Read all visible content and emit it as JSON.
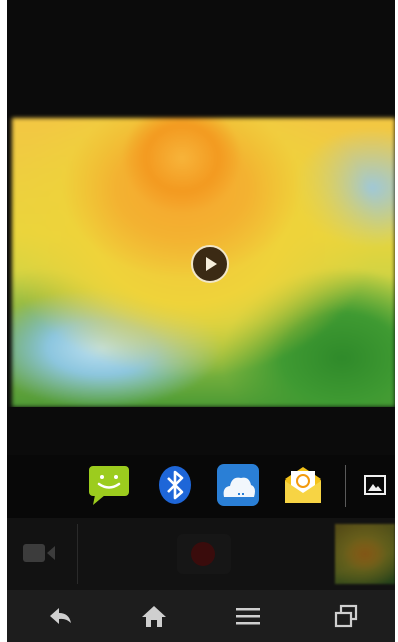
{
  "camera": {
    "preview": {
      "subject": "sunflower-video-frame",
      "play_icon": "play-icon"
    },
    "share_apps": [
      {
        "icon": "messaging-icon",
        "color": "#9ccc1e"
      },
      {
        "icon": "bluetooth-icon",
        "color": "#1e66d8"
      },
      {
        "icon": "cloud-storage-icon",
        "color": "#2a7fd6"
      },
      {
        "icon": "email-icon",
        "color": "#f3c21a"
      }
    ],
    "controls": {
      "mode_icon": "video-camera-icon",
      "shutter_icon": "record-icon",
      "thumbnail": "last-capture-thumbnail"
    }
  },
  "nav": {
    "buttons": [
      "back-icon",
      "home-icon",
      "menu-icon",
      "recent-apps-icon"
    ]
  },
  "colors": {
    "background": "#0c0c0c",
    "nav_bar": "#1d1d1d",
    "record": "#3a0c0c"
  }
}
